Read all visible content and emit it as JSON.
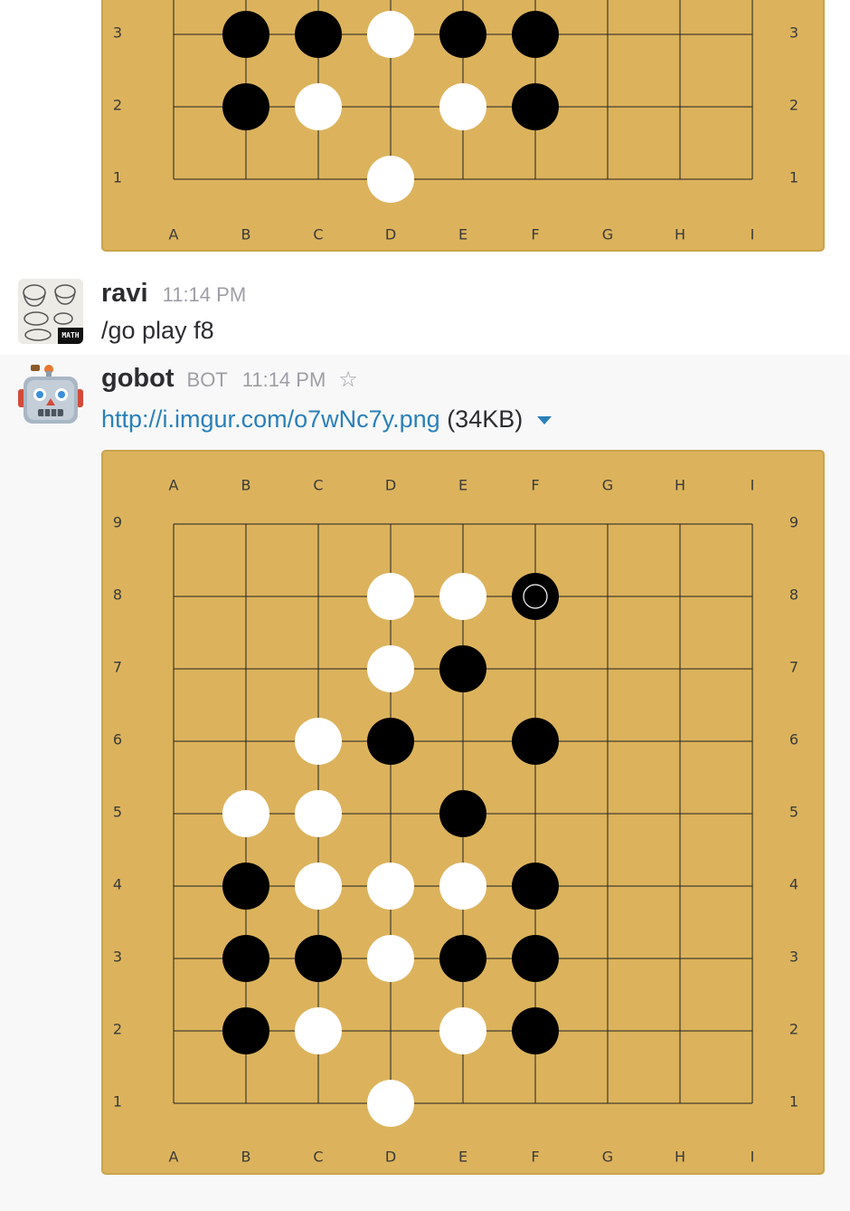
{
  "colors": {
    "board": "#dcb35c",
    "board_border": "#c9a44c",
    "link": "#2a80b9",
    "text": "#2c2d30",
    "muted": "#9e9ea6"
  },
  "board_columns": [
    "A",
    "B",
    "C",
    "D",
    "E",
    "F",
    "G",
    "H",
    "I"
  ],
  "board_rows": [
    "9",
    "8",
    "7",
    "6",
    "5",
    "4",
    "3",
    "2",
    "1"
  ],
  "previous_board": {
    "visible_rows": [
      "3",
      "2",
      "1"
    ],
    "stones": [
      {
        "pt": "B3",
        "color": "black"
      },
      {
        "pt": "C3",
        "color": "black"
      },
      {
        "pt": "D3",
        "color": "white"
      },
      {
        "pt": "E3",
        "color": "black"
      },
      {
        "pt": "F3",
        "color": "black"
      },
      {
        "pt": "B2",
        "color": "black"
      },
      {
        "pt": "C2",
        "color": "white"
      },
      {
        "pt": "E2",
        "color": "white"
      },
      {
        "pt": "F2",
        "color": "black"
      },
      {
        "pt": "D1",
        "color": "white"
      }
    ]
  },
  "messages": [
    {
      "avatar_icon": "coffee-doodle-avatar",
      "avatar_text": "MATH",
      "username": "ravi",
      "time": "11:14 PM",
      "text": "/go play f8"
    },
    {
      "avatar_icon": "robot-face-icon",
      "username": "gobot",
      "bot_tag": "BOT",
      "time": "11:14 PM",
      "star_icon": "star-outline-icon",
      "link_text": "http://i.imgur.com/o7wNc7y.png",
      "file_size": "(34KB)",
      "expand_icon": "caret-down-icon"
    }
  ],
  "current_board": {
    "last_move": "F8",
    "stones": [
      {
        "pt": "D8",
        "color": "white"
      },
      {
        "pt": "E8",
        "color": "white"
      },
      {
        "pt": "F8",
        "color": "black"
      },
      {
        "pt": "D7",
        "color": "white"
      },
      {
        "pt": "E7",
        "color": "black"
      },
      {
        "pt": "C6",
        "color": "white"
      },
      {
        "pt": "D6",
        "color": "black"
      },
      {
        "pt": "F6",
        "color": "black"
      },
      {
        "pt": "B5",
        "color": "white"
      },
      {
        "pt": "C5",
        "color": "white"
      },
      {
        "pt": "E5",
        "color": "black"
      },
      {
        "pt": "B4",
        "color": "black"
      },
      {
        "pt": "C4",
        "color": "white"
      },
      {
        "pt": "D4",
        "color": "white"
      },
      {
        "pt": "E4",
        "color": "white"
      },
      {
        "pt": "F4",
        "color": "black"
      },
      {
        "pt": "B3",
        "color": "black"
      },
      {
        "pt": "C3",
        "color": "black"
      },
      {
        "pt": "D3",
        "color": "white"
      },
      {
        "pt": "E3",
        "color": "black"
      },
      {
        "pt": "F3",
        "color": "black"
      },
      {
        "pt": "B2",
        "color": "black"
      },
      {
        "pt": "C2",
        "color": "white"
      },
      {
        "pt": "E2",
        "color": "white"
      },
      {
        "pt": "F2",
        "color": "black"
      },
      {
        "pt": "D1",
        "color": "white"
      }
    ]
  }
}
